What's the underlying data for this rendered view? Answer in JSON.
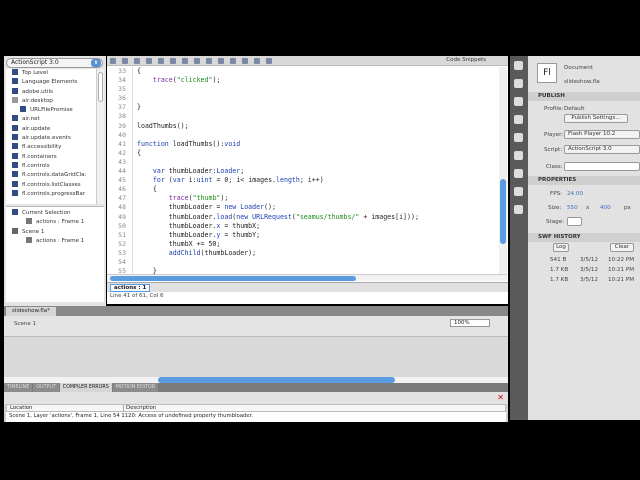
{
  "library": {
    "language": "ActionScript 3.0",
    "items": [
      "Top Level",
      "Language Elements",
      "adobe.utils",
      "air.desktop",
      "URLFilePromise",
      "air.net",
      "air.update",
      "air.update.events",
      "fl.accessibility",
      "fl.containers",
      "fl.controls",
      "fl.controls.dataGridCla:",
      "fl.controls.listClasses",
      "fl.controls.progressBar"
    ],
    "nav": {
      "current_selection": "Current Selection",
      "current_frame": "actions : Frame 1",
      "scene": "Scene 1",
      "scene_frame": "actions : Frame 1"
    }
  },
  "editor": {
    "code_snippets": "Code Snippets",
    "line_numbers": [
      "33",
      "34",
      "35",
      "36",
      "37",
      "38",
      "39",
      "40",
      "41",
      "42",
      "43",
      "44",
      "45",
      "46",
      "47",
      "48",
      "49",
      "50",
      "51",
      "52",
      "53",
      "54",
      "55"
    ],
    "tab": "actions : 1",
    "status": "Line 41 of 61, Col 6"
  },
  "properties": {
    "doc_type": "Document",
    "file": "slideshow.fla",
    "fl": "Fl",
    "publish": {
      "title": "PUBLISH",
      "profile_label": "Profile:",
      "profile": "Default",
      "settings_button": "Publish Settings...",
      "player_label": "Player:",
      "player": "Flash Player 10.2",
      "script_label": "Script:",
      "script": "ActionScript 3.0",
      "class_label": "Class:"
    },
    "props": {
      "title": "PROPERTIES",
      "fps_label": "FPS:",
      "fps": "24.00",
      "size_label": "Size:",
      "width": "550",
      "x": "x",
      "height": "400",
      "unit": "px",
      "stage_label": "Stage:"
    },
    "history": {
      "title": "SWF HISTORY",
      "log": "Log",
      "clear": "Clear",
      "rows": [
        [
          "541 B",
          "3/5/12",
          "10:22 PM"
        ],
        [
          "1.7 KB",
          "3/5/12",
          "10:21 PM"
        ],
        [
          "1.7 KB",
          "3/5/12",
          "10:21 PM"
        ]
      ]
    }
  },
  "document": {
    "tab": "slideshow.fla*",
    "scene": "Scene 1",
    "zoom": "100%"
  },
  "panels": {
    "tabs": [
      "TIMELINE",
      "OUTPUT",
      "COMPILER ERRORS",
      "MOTION EDITOR"
    ],
    "active": 2,
    "headers": {
      "location": "Location",
      "description": "Description"
    },
    "error": "Scene 1, Layer 'actions', Frame 1, Line 54   1120: Access of undefined property thumbloader."
  }
}
